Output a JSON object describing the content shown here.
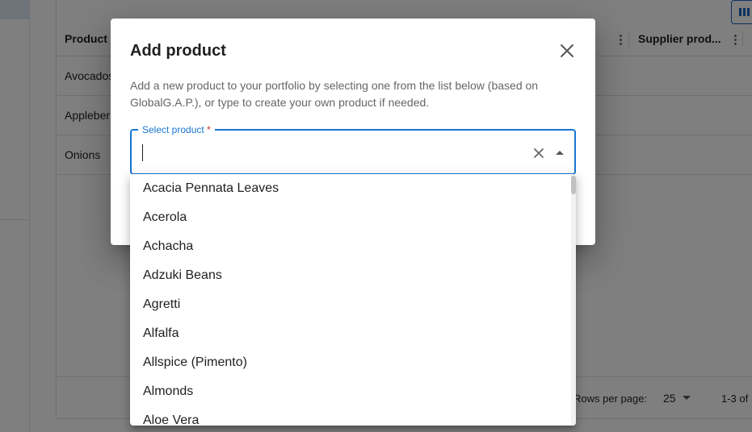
{
  "background": {
    "columns": {
      "product": "Product n",
      "supplier": "Supplier prod..."
    },
    "rows": [
      "Avocados",
      "Appleber",
      "Onions"
    ],
    "pagination": {
      "rows_per_page_label": "Rows per page:",
      "rows_per_page_value": "25",
      "range": "1-3 of"
    }
  },
  "dialog": {
    "title": "Add product",
    "description": "Add a new product to your portfolio by selecting one from the list below (based on GlobalG.A.P.), or type to create your own product if needed.",
    "field": {
      "label": "Select product",
      "required_marker": "*",
      "value": ""
    }
  },
  "dropdown": {
    "options": [
      "Acacia Pennata Leaves",
      "Acerola",
      "Achacha",
      "Adzuki Beans",
      "Agretti",
      "Alfalfa",
      "Allspice (Pimento)",
      "Almonds",
      "Aloe Vera"
    ]
  },
  "icons": {
    "close": "close-icon",
    "clear": "clear-icon",
    "toggle": "arrow-up-icon",
    "columns": "column-menu-icon",
    "toolbar": "columns-icon"
  },
  "colors": {
    "accent": "#1976d2",
    "required": "#d32f2f",
    "scrim": "rgba(0,0,0,0.5)"
  }
}
